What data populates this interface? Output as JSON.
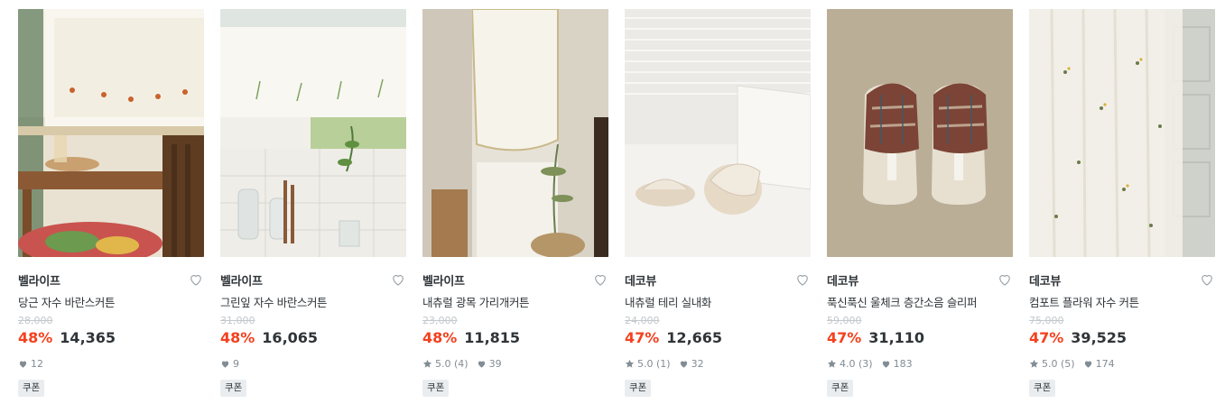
{
  "products": [
    {
      "brand": "벨라이프",
      "name": "당근 자수 바란스커튼",
      "original_price": "28,000",
      "discount": "48%",
      "price": "14,365",
      "rating": "",
      "review_count": "",
      "likes": "12",
      "badge": "쿠폰",
      "image": "curtain-carrot-kitchen"
    },
    {
      "brand": "벨라이프",
      "name": "그린잎 자수 바란스커튼",
      "original_price": "31,000",
      "discount": "48%",
      "price": "16,065",
      "rating": "",
      "review_count": "",
      "likes": "9",
      "badge": "쿠폰",
      "image": "curtain-leaf-window"
    },
    {
      "brand": "벨라이프",
      "name": "내츄럴 광목 가리개커튼",
      "original_price": "23,000",
      "discount": "48%",
      "price": "11,815",
      "rating": "5.0",
      "review_count": "(4)",
      "likes": "39",
      "badge": "쿠폰",
      "image": "curtain-cotton-door"
    },
    {
      "brand": "데코뷰",
      "name": "내츄럴 테리 실내화",
      "original_price": "24,000",
      "discount": "47%",
      "price": "12,665",
      "rating": "5.0",
      "review_count": "(1)",
      "likes": "32",
      "badge": "쿠폰",
      "image": "slippers-terry"
    },
    {
      "brand": "데코뷰",
      "name": "푹신푹신 울체크 층간소음 슬리퍼",
      "original_price": "59,000",
      "discount": "47%",
      "price": "31,110",
      "rating": "4.0",
      "review_count": "(3)",
      "likes": "183",
      "badge": "쿠폰",
      "image": "slippers-wool-check"
    },
    {
      "brand": "데코뷰",
      "name": "컴포트 플라워 자수 커튼",
      "original_price": "75,000",
      "discount": "47%",
      "price": "39,525",
      "rating": "5.0",
      "review_count": "(5)",
      "likes": "174",
      "badge": "쿠폰",
      "image": "curtain-flower-sheer"
    }
  ],
  "colors": {
    "discount": "#f5401e",
    "text": "#2f3438",
    "muted": "#828c94",
    "strike": "#c2c8cc",
    "badge_bg": "#eaedef"
  }
}
